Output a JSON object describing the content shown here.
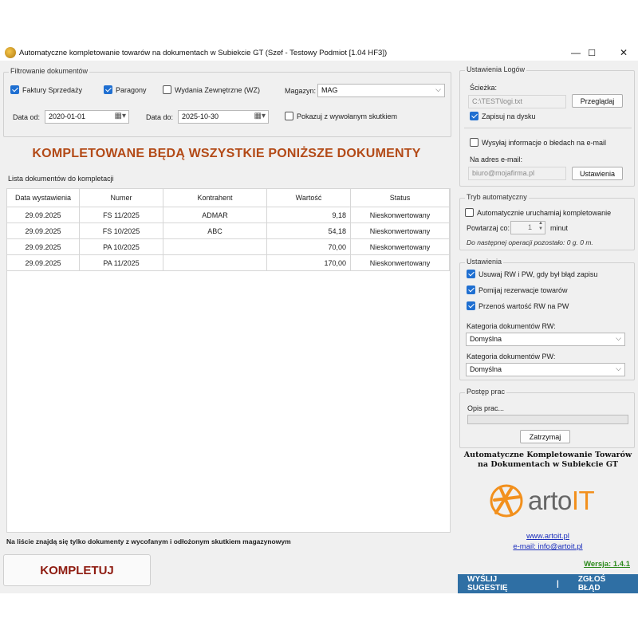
{
  "window": {
    "title": "Automatyczne kompletowanie towarów na dokumentach w Subiekcie GT (Szef - Testowy Podmiot [1.04 HF3])",
    "minimize": "—",
    "maximize": "☐",
    "close": "✕"
  },
  "filter": {
    "group_title": "Filtrowanie dokumentów",
    "faktury_label": "Faktury Sprzedaży",
    "paragony_label": "Paragony",
    "wz_label": "Wydania Zewnętrzne (WZ)",
    "magazyn_label": "Magazyn:",
    "magazyn_value": "MAG",
    "date_from_label": "Data od:",
    "date_from_value": "2020-01-01",
    "date_to_label": "Data do:",
    "date_to_value": "2025-10-30",
    "show_with_effect_label": "Pokazuj z wywołanym skutkiem",
    "faktury_checked": true,
    "paragony_checked": true,
    "wz_checked": false,
    "show_with_effect_checked": false
  },
  "banner": "KOMPLETOWANE BĘDĄ WSZYSTKIE PONIŻSZE DOKUMENTY",
  "list": {
    "title": "Lista dokumentów do kompletacji",
    "columns": [
      "Data wystawienia",
      "Numer",
      "Kontrahent",
      "Wartość",
      "Status"
    ],
    "rows": [
      {
        "date": "29.09.2025",
        "number": "FS 11/2025",
        "contractor": "ADMAR",
        "value": "9,18",
        "status": "Nieskonwertowany"
      },
      {
        "date": "29.09.2025",
        "number": "FS 10/2025",
        "contractor": "ABC",
        "value": "54,18",
        "status": "Nieskonwertowany"
      },
      {
        "date": "29.09.2025",
        "number": "PA 10/2025",
        "contractor": "",
        "value": "70,00",
        "status": "Nieskonwertowany"
      },
      {
        "date": "29.09.2025",
        "number": "PA 11/2025",
        "contractor": "",
        "value": "170,00",
        "status": "Nieskonwertowany"
      }
    ],
    "footer_note": "Na liście znajdą się tylko dokumenty z wycofanym i odłożonym skutkiem magazynowym"
  },
  "complete_button": "KOMPLETUJ",
  "logs": {
    "group_title": "Ustawienia Logów",
    "path_label": "Ścieżka:",
    "path_value": "C:\\TEST\\logi.txt",
    "browse_button": "Przeglądaj",
    "save_to_disk_label": "Zapisuj na dysku",
    "save_to_disk_checked": true,
    "send_errors_label": "Wysyłaj informacje o błedach na e-mail",
    "send_errors_checked": false,
    "email_label": "Na adres e-mail:",
    "email_value": "biuro@mojafirma.pl",
    "settings_button": "Ustawienia"
  },
  "auto": {
    "group_title": "Tryb automatyczny",
    "auto_run_label": "Automatycznie uruchamiaj kompletowanie",
    "auto_run_checked": false,
    "repeat_label": "Powtarzaj co:",
    "repeat_value": "1",
    "repeat_unit": "minut",
    "next_run_text": "Do następnej operacji pozostało: 0 g. 0 m."
  },
  "settings": {
    "group_title": "Ustawienia",
    "delete_rw_pw_label": "Usuwaj RW i PW, gdy był błąd zapisu",
    "delete_rw_pw_checked": true,
    "skip_reservations_label": "Pomijaj rezerwacje towarów",
    "skip_reservations_checked": true,
    "transfer_value_label": "Przenoś wartość RW na PW",
    "transfer_value_checked": true,
    "rw_category_label": "Kategoria dokumentów RW:",
    "rw_category_value": "Domyślna",
    "pw_category_label": "Kategoria dokumentów PW:",
    "pw_category_value": "Domyślna"
  },
  "progress": {
    "group_title": "Postęp prac",
    "description": "Opis prac...",
    "percent": 0,
    "stop_button": "Zatrzymaj"
  },
  "brand": {
    "line1": "Automatyczne Kompletowanie Towarów",
    "line2": "na Dokumentach w Subiekcie GT",
    "logo_prefix": "arto",
    "logo_suffix": "IT",
    "website": "www.artoit.pl",
    "email": "e-mail: info@artoit.pl",
    "version": "Wersja: 1.4.1",
    "suggest_button": "WYŚLIJ SUGESTIĘ",
    "separator": "|",
    "report_bug_button": "ZGŁOŚ BŁĄD"
  },
  "colors": {
    "accent": "#1f6fd1",
    "banner": "#b34a17",
    "complete_button_text": "#8e1b10",
    "action_bar": "#2f6fa4",
    "logo_orange": "#f2901d",
    "version_green": "#2c8a1c"
  }
}
